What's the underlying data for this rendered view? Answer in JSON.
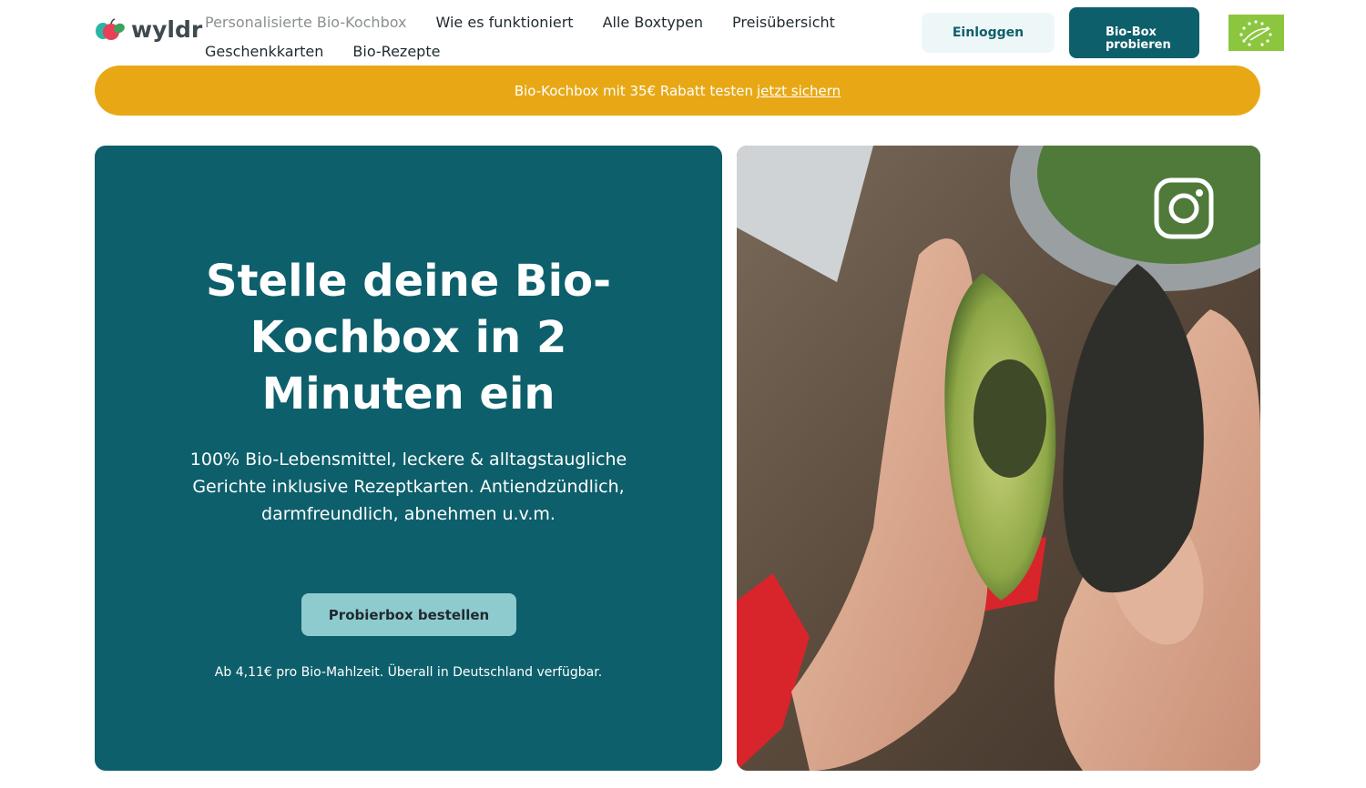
{
  "brand": {
    "name": "wyldr"
  },
  "nav": {
    "row1": [
      "Personalisierte Bio-Kochbox",
      "Wie es funktioniert",
      "Alle Boxtypen",
      "Preisübersicht"
    ],
    "row2": [
      "Geschenkkarten",
      "Bio-Rezepte"
    ]
  },
  "header": {
    "login_label": "Einloggen",
    "try_line1": "Bio-Box",
    "try_line2": "probieren"
  },
  "banner": {
    "text": "Bio-Kochbox mit 35€ Rabatt testen",
    "link": "jetzt sichern"
  },
  "hero": {
    "title": "Stelle deine Bio-Kochbox in 2 Minuten ein",
    "subtitle": "100% Bio-Lebensmittel, leckere & alltagstaugliche Gerichte inklusive Rezeptkarten. Antiendzündlich, darmfreundlich, abnehmen u.v.m.",
    "cta": "Probierbox bestellen",
    "note": "Ab 4,11€ pro Bio-Mahlzeit. Überall in Deutschland verfügbar."
  },
  "colors": {
    "brand_teal": "#0d5f6b",
    "banner_yellow": "#e8a816",
    "cta_light": "#8ecbcf",
    "eu_green": "#8cc63f"
  },
  "icons": [
    "wyldr-logo-icon",
    "eu-organic-logo-icon",
    "instagram-icon"
  ]
}
